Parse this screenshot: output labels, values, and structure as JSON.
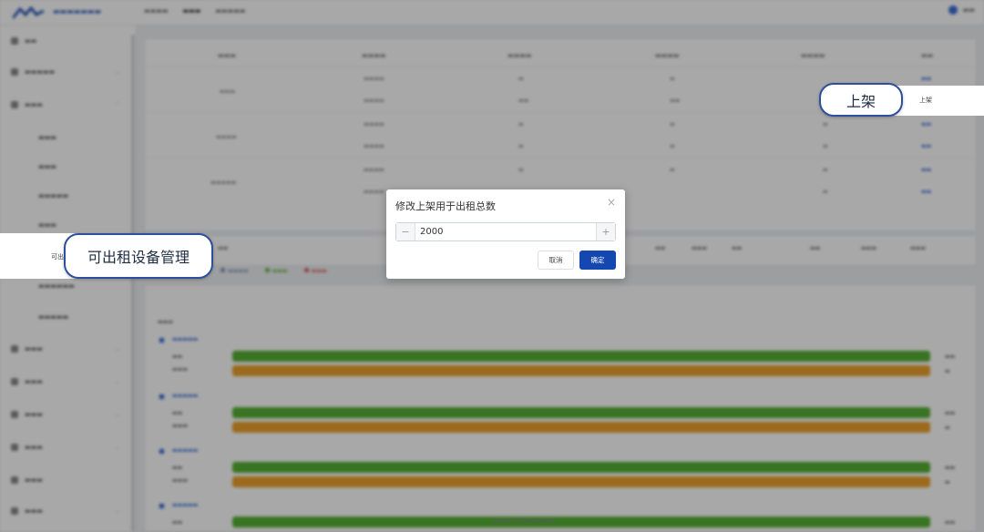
{
  "colors": {
    "accent": "#1448b0",
    "callout_border": "#2d4f9e",
    "bar_green": "#55b133",
    "bar_orange": "#eba12b"
  },
  "callouts": {
    "right": {
      "pill": "上架",
      "band_text": "上架"
    },
    "left": {
      "pill": "可出租设备管理",
      "band_text": "可出"
    }
  },
  "modal": {
    "title": "修改上架用于出租总数",
    "close_icon": "close-icon",
    "stepper": {
      "value": "2000",
      "minus_icon": "minus-icon",
      "plus_icon": "plus-icon"
    },
    "cancel_label": "取消",
    "confirm_label": "确定"
  }
}
